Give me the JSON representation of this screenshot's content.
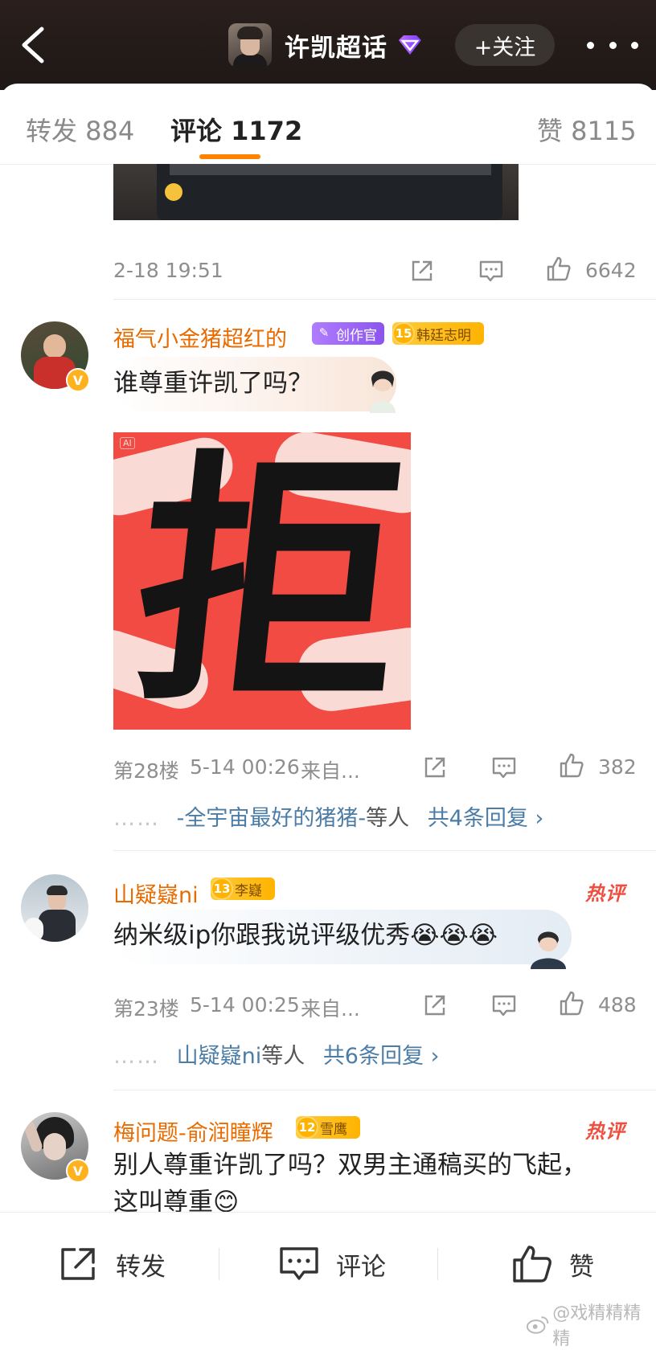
{
  "header": {
    "title": "许凯超话",
    "follow_label": "+关注",
    "back_icon": "chevron-left-icon",
    "more_icon": "more-dots-icon"
  },
  "tabs": [
    {
      "label": "转发 884"
    },
    {
      "label": "评论 1172"
    },
    {
      "label": "赞 8115"
    }
  ],
  "prev_comment": {
    "time": "2-18 19:51",
    "likes": "6642"
  },
  "comments": [
    {
      "username": "福气小金猪超红的",
      "badge_creator": "创作官",
      "badge_fan_level": "15",
      "badge_fan_name": "韩廷志明",
      "text": "谁尊重许凯了吗？",
      "image_char": "拒",
      "image_tag": "AI",
      "floor": "第28楼",
      "time": "5-14 00:26",
      "source": "来自...",
      "likes": "382",
      "reply_dots": "……",
      "reply_names": "-全宇宙最好的猪猪-",
      "reply_mid": "等人",
      "reply_total": "共4条回复 ›"
    },
    {
      "username": "山疑嶷ni",
      "badge_fan_level": "13",
      "badge_fan_name": "李嶷",
      "hot_label": "热评",
      "text": "纳米级ip你跟我说评级优秀😭😭😭",
      "floor": "第23楼",
      "time": "5-14 00:25",
      "source": "来自...",
      "likes": "488",
      "reply_dots": "……",
      "reply_names": "山疑嶷ni",
      "reply_mid": "等人",
      "reply_total": "共6条回复 ›"
    },
    {
      "username": "梅问题-俞润瞳辉",
      "badge_fan_level": "12",
      "badge_fan_name": "雪鹰",
      "hot_label": "热评",
      "text_line1": "别人尊重许凯了吗？双男主通稿买的飞起，",
      "text_line2": "这叫尊重😊"
    }
  ],
  "bottom_bar": {
    "repost": "转发",
    "comment": "评论",
    "like": "赞"
  },
  "watermark": "@戏精精精精",
  "colors": {
    "accent_orange": "#ff8200",
    "username_orange": "#e86b00",
    "link_blue": "#4c7da6",
    "hot_red": "#ef4f40"
  }
}
